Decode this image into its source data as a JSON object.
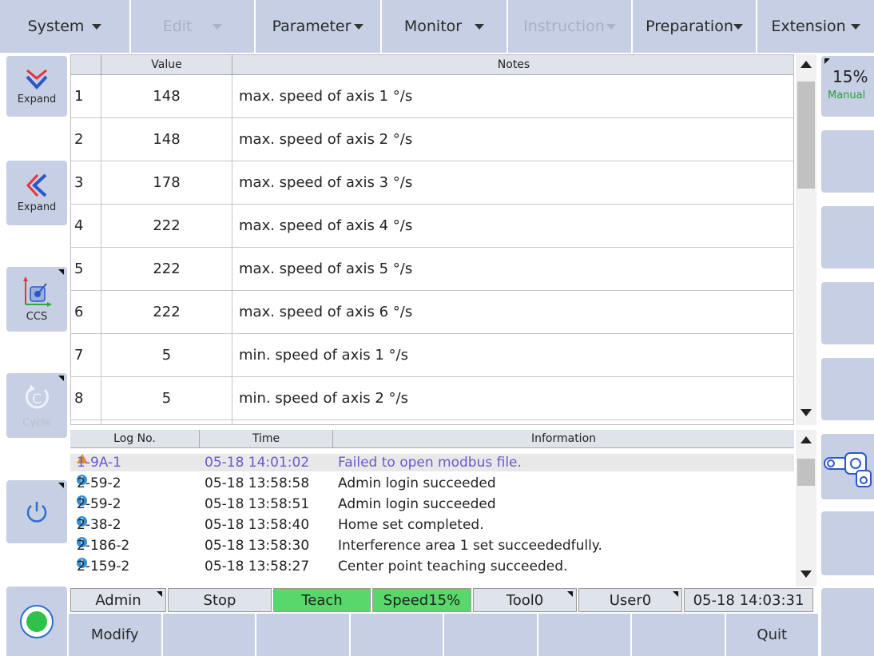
{
  "menu": {
    "items": [
      {
        "label": "System",
        "disabled": false
      },
      {
        "label": "Edit",
        "disabled": true
      },
      {
        "label": "Parameter",
        "disabled": false
      },
      {
        "label": "Monitor",
        "disabled": false
      },
      {
        "label": "Instruction",
        "disabled": true
      },
      {
        "label": "Preparation",
        "disabled": false
      },
      {
        "label": "Extension",
        "disabled": false
      }
    ]
  },
  "left": {
    "expand_down_label": "Expand",
    "expand_left_label": "Expand",
    "ccs_label": "CCS",
    "cycle_label": "Cycle"
  },
  "params": {
    "headers": {
      "index": "",
      "value": "Value",
      "notes": "Notes"
    },
    "rows": [
      {
        "index": "1",
        "value": "148",
        "notes": "max. speed of axis 1  °/s"
      },
      {
        "index": "2",
        "value": "148",
        "notes": "max. speed of axis 2  °/s"
      },
      {
        "index": "3",
        "value": "178",
        "notes": "max. speed of axis 3  °/s"
      },
      {
        "index": "4",
        "value": "222",
        "notes": "max. speed of axis 4  °/s"
      },
      {
        "index": "5",
        "value": "222",
        "notes": "max. speed of axis 5  °/s"
      },
      {
        "index": "6",
        "value": "222",
        "notes": "max. speed of axis 6  °/s"
      },
      {
        "index": "7",
        "value": "5",
        "notes": "min. speed of axis  1  °/s"
      },
      {
        "index": "8",
        "value": "5",
        "notes": "min. speed of axis  2  °/s"
      }
    ]
  },
  "log": {
    "headers": {
      "no": "Log No.",
      "time": "Time",
      "info": "Information"
    },
    "rows": [
      {
        "icon": "warning-icon",
        "no": "1-9A-1",
        "time": "05-18 14:01:02",
        "info": "Failed to open modbus file."
      },
      {
        "icon": "info-icon",
        "no": "2-59-2",
        "time": "05-18 13:58:58",
        "info": "Admin  login succeeded"
      },
      {
        "icon": "info-icon",
        "no": "2-59-2",
        "time": "05-18 13:58:51",
        "info": "Admin  login succeeded"
      },
      {
        "icon": "info-icon",
        "no": "2-38-2",
        "time": "05-18 13:58:40",
        "info": "Home set completed."
      },
      {
        "icon": "info-icon",
        "no": "2-186-2",
        "time": "05-18 13:58:30",
        "info": "Interference area 1 set succeededfully."
      },
      {
        "icon": "info-icon",
        "no": "2-159-2",
        "time": "05-18 13:58:27",
        "info": "Center point teaching succeeded."
      }
    ]
  },
  "status": {
    "user": "Admin",
    "state": "Stop",
    "mode": "Teach",
    "speed": "Speed15%",
    "tool": "Tool0",
    "user_frame": "User0",
    "datetime": "05-18 14:03:31"
  },
  "fkeys": {
    "f1": "Modify",
    "f2": "",
    "f3": "",
    "f4": "",
    "f5": "",
    "f6": "",
    "f7": "",
    "f8": "Quit"
  },
  "right": {
    "speed": "15%",
    "mode": "Manual"
  },
  "colors": {
    "button_bg": "#c6cfe3",
    "accent_green": "#58d86b",
    "warning": "#e08a2c",
    "info": "#2f8fd8",
    "selected_text": "#6a5acd"
  }
}
